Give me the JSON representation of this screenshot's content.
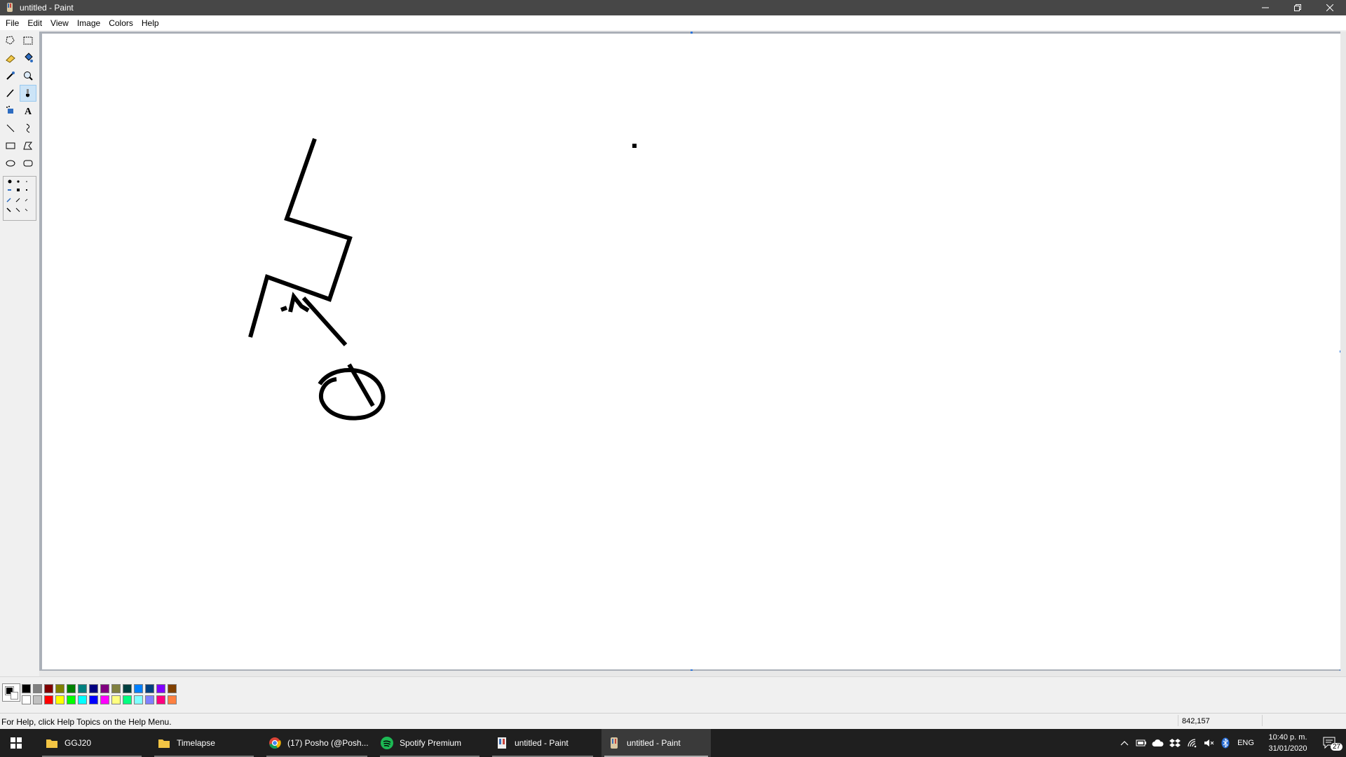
{
  "window": {
    "title": "untitled - Paint",
    "controls": [
      "minimize",
      "restore",
      "close"
    ]
  },
  "menu": [
    "File",
    "Edit",
    "View",
    "Image",
    "Colors",
    "Help"
  ],
  "tools": [
    {
      "name": "free-form-select-icon"
    },
    {
      "name": "select-icon"
    },
    {
      "name": "eraser-icon"
    },
    {
      "name": "fill-icon"
    },
    {
      "name": "color-picker-icon"
    },
    {
      "name": "magnifier-icon"
    },
    {
      "name": "pencil-icon"
    },
    {
      "name": "brush-icon",
      "selected": true
    },
    {
      "name": "airbrush-icon"
    },
    {
      "name": "text-icon"
    },
    {
      "name": "line-icon"
    },
    {
      "name": "curve-icon"
    },
    {
      "name": "rectangle-icon"
    },
    {
      "name": "polygon-icon"
    },
    {
      "name": "ellipse-icon"
    },
    {
      "name": "rounded-rectangle-icon"
    }
  ],
  "colors": {
    "foreground": "#000000",
    "background": "#ffffff",
    "palette_top": [
      "#000000",
      "#808080",
      "#800000",
      "#808000",
      "#008000",
      "#008080",
      "#000080",
      "#800080",
      "#808040",
      "#004040",
      "#0080ff",
      "#004080",
      "#8000ff",
      "#804000"
    ],
    "palette_bottom": [
      "#ffffff",
      "#c0c0c0",
      "#ff0000",
      "#ffff00",
      "#00ff00",
      "#00ffff",
      "#0000ff",
      "#ff00ff",
      "#ffff80",
      "#00ff80",
      "#80ffff",
      "#8080ff",
      "#ff0080",
      "#ff8040"
    ]
  },
  "status": {
    "help": "For Help, click Help Topics on the Help Menu.",
    "coords": "842,157"
  },
  "taskbar": {
    "items": [
      {
        "label": "GGJ20",
        "icon": "folder-icon"
      },
      {
        "label": "Timelapse",
        "icon": "folder-icon"
      },
      {
        "label": "(17) Posho (@Posh...",
        "icon": "chrome-icon"
      },
      {
        "label": "Spotify Premium",
        "icon": "spotify-icon"
      },
      {
        "label": "untitled - Paint",
        "icon": "paint-icon"
      },
      {
        "label": "untitled - Paint",
        "icon": "paint-icon",
        "active": true
      }
    ],
    "tray": {
      "language": "ENG",
      "time": "10:40 p. m.",
      "date": "31/01/2020",
      "notifications": "27"
    }
  }
}
